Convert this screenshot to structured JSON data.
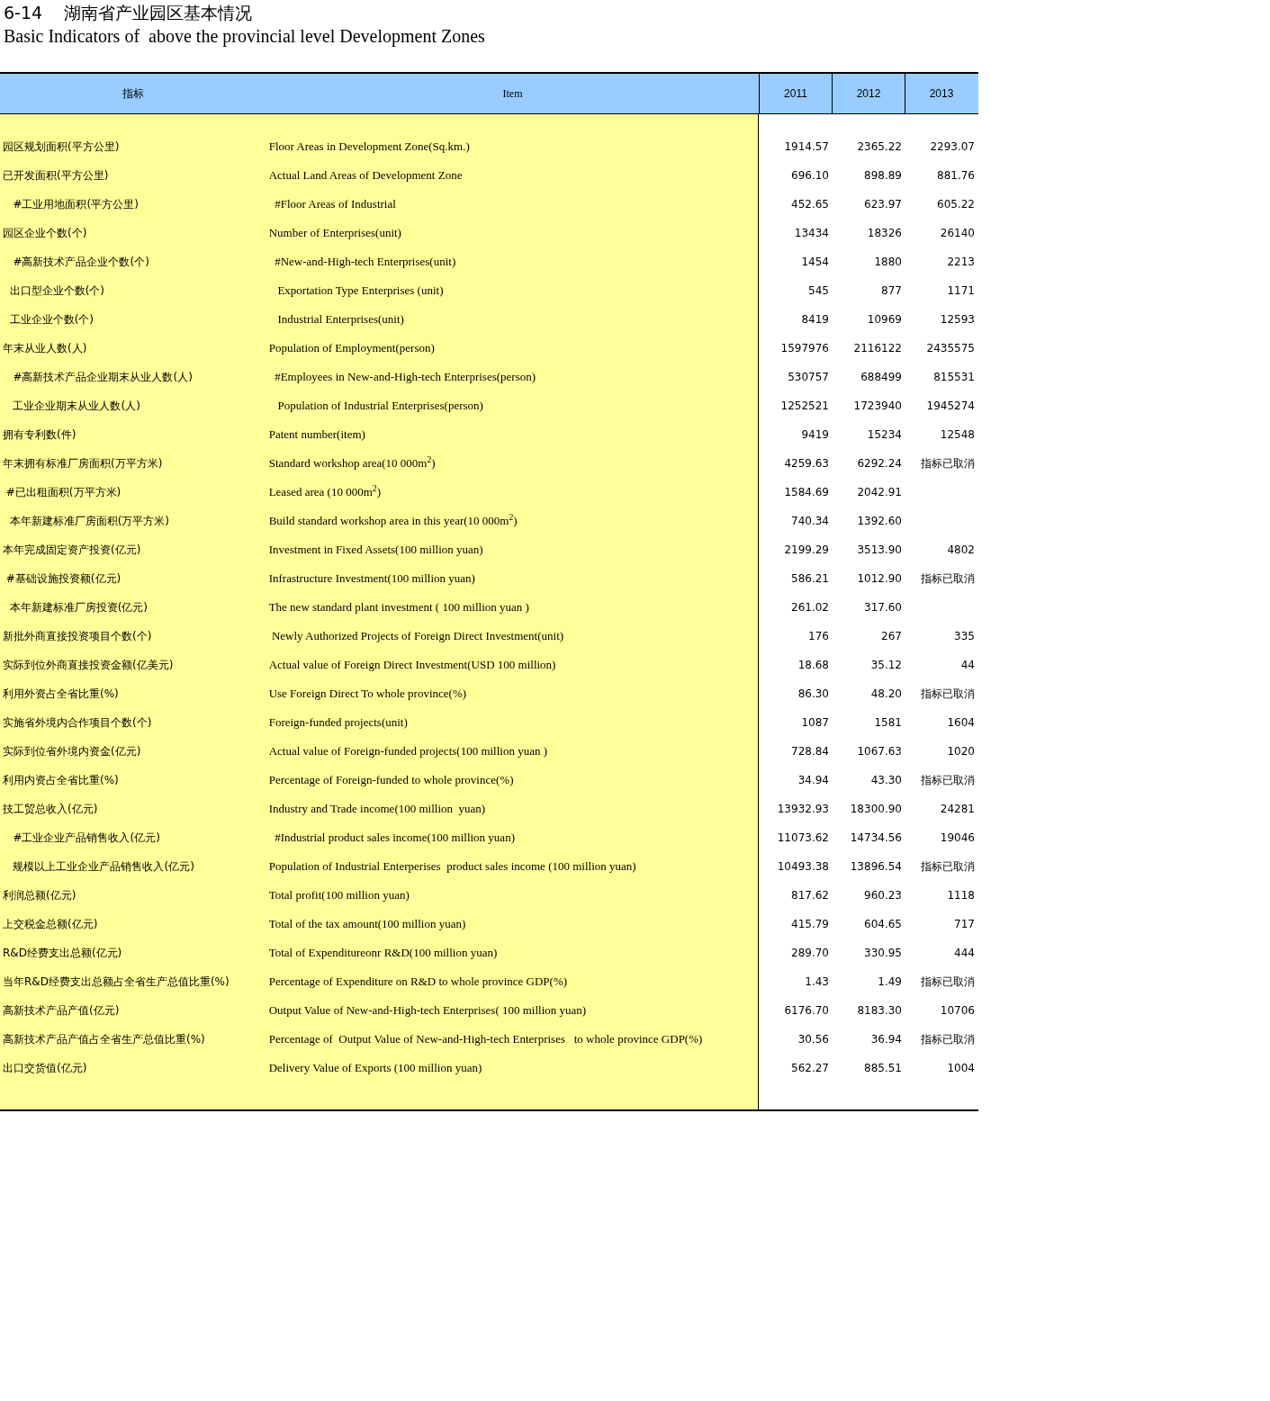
{
  "title": "6-14    湖南省产业园区基本情况",
  "subtitle": "Basic Indicators of  above the provincial level Development Zones",
  "columns": [
    "指标",
    "Item",
    "2011",
    "2012",
    "2013"
  ],
  "rows": [
    {
      "zh": "园区规划面积(平方公里)",
      "en": "Floor Areas in Development Zone(Sq.km.)",
      "value_2011": "1914.57",
      "value_2012": "2365.22",
      "value_2013": "2293.07"
    },
    {
      "zh": "已开发面积(平方公里)",
      "en": "Actual Land Areas of Development Zone",
      "value_2011": "696.10",
      "value_2012": "898.89",
      "value_2013": "881.76"
    },
    {
      "zh": "   #工业用地面积(平方公里)",
      "en": "  #Floor Areas of Industrial",
      "value_2011": "452.65",
      "value_2012": "623.97",
      "value_2013": "605.22"
    },
    {
      "zh": "园区企业个数(个)",
      "en": "Number of Enterprises(unit)",
      "value_2011": "13434",
      "value_2012": "18326",
      "value_2013": "26140"
    },
    {
      "zh": "   #高新技术产品企业个数(个)",
      "en": "  #New-and-High-tech Enterprises(unit)",
      "value_2011": "1454",
      "value_2012": "1880",
      "value_2013": "2213"
    },
    {
      "zh": "  出口型企业个数(个)",
      "en": "   Exportation Type Enterprises (unit)",
      "value_2011": "545",
      "value_2012": "877",
      "value_2013": "1171"
    },
    {
      "zh": "  工业企业个数(个)",
      "en": "   Industrial Enterprises(unit)",
      "value_2011": "8419",
      "value_2012": "10969",
      "value_2013": "12593"
    },
    {
      "zh": "年末从业人数(人)",
      "en": "Population of Employment(person)",
      "value_2011": "1597976",
      "value_2012": "2116122",
      "value_2013": "2435575"
    },
    {
      "zh": "   #高新技术产品企业期末从业人数(人)",
      "en": "  #Employees in New-and-High-tech Enterprises(person)",
      "value_2011": "530757",
      "value_2012": "688499",
      "value_2013": "815531"
    },
    {
      "zh": "   工业企业期末从业人数(人)",
      "en": "   Population of Industrial Enterprises(person)",
      "value_2011": "1252521",
      "value_2012": "1723940",
      "value_2013": "1945274"
    },
    {
      "zh": "拥有专利数(件)",
      "en": "Patent number(item)",
      "value_2011": "9419",
      "value_2012": "15234",
      "value_2013": "12548"
    },
    {
      "zh": "年末拥有标准厂房面积(万平方米)",
      "en": "Standard workshop area(10 000m$^{2}$)",
      "value_2011": "4259.63",
      "value_2012": "6292.24",
      "value_2013": "指标已取消"
    },
    {
      "zh": " #已出租面积(万平方米)",
      "en": "Leased area (10 000m$^{2}$)",
      "value_2011": "1584.69",
      "value_2012": "2042.91"
    },
    {
      "zh": "  本年新建标准厂房面积(万平方米)",
      "en": "Build standard workshop area in this year(10 000m$^{2}$)",
      "value_2011": "740.34",
      "value_2012": "1392.60"
    },
    {
      "zh": "本年完成固定资产投资(亿元)",
      "en": "Investment in Fixed Assets(100 million yuan)",
      "value_2011": "2199.29",
      "value_2012": "3513.90",
      "value_2013": "4802"
    },
    {
      "zh": " #基础设施投资额(亿元)",
      "en": "Infrastructure Investment(100 million yuan)",
      "value_2011": "586.21",
      "value_2012": "1012.90",
      "value_2013": "指标已取消"
    },
    {
      "zh": "  本年新建标准厂房投资(亿元)",
      "en": "The new standard plant investment ( 100 million yuan )",
      "value_2011": "261.02",
      "value_2012": "317.60"
    },
    {
      "zh": "新批外商直接投资项目个数(个)",
      "en": " Newly Authorized Projects of Foreign Direct Investment(unit)",
      "value_2011": "176",
      "value_2012": "267",
      "value_2013": "335"
    },
    {
      "zh": "实际到位外商直接投资金额(亿美元)",
      "en": "Actual value of Foreign Direct Investment(USD 100 million)",
      "value_2011": "18.68",
      "value_2012": "35.12",
      "value_2013": "44"
    },
    {
      "zh": "利用外资占全省比重(%)",
      "en": "Use Foreign Direct To whole province(%)",
      "value_2011": "86.30",
      "value_2012": "48.20",
      "value_2013": "指标已取消"
    },
    {
      "zh": "实施省外境内合作项目个数(个)",
      "en": "Foreign-funded projects(unit)",
      "value_2011": "1087",
      "value_2012": "1581",
      "value_2013": "1604"
    },
    {
      "zh": "实际到位省外境内资金(亿元)",
      "en": "Actual value of Foreign-funded projects(100 million yuan )",
      "value_2011": "728.84",
      "value_2012": "1067.63",
      "value_2013": "1020"
    },
    {
      "zh": "利用内资占全省比重(%)",
      "en": "Percentage of Foreign-funded to whole province(%)",
      "value_2011": "34.94",
      "value_2012": "43.30",
      "value_2013": "指标已取消"
    },
    {
      "zh": "技工贸总收入(亿元)",
      "en": "Industry and Trade income(100 million  yuan)",
      "value_2011": "13932.93",
      "value_2012": "18300.90",
      "value_2013": "24281"
    },
    {
      "zh": "   #工业企业产品销售收入(亿元)",
      "en": "  #Industrial product sales income(100 million yuan)",
      "value_2011": "11073.62",
      "value_2012": "14734.56",
      "value_2013": "19046"
    },
    {
      "zh": "   规模以上工业企业产品销售收入(亿元)",
      "en": "Population of Industrial Enterperises  product sales income (100 million yuan)",
      "value_2011": "10493.38",
      "value_2012": "13896.54",
      "value_2013": "指标已取消"
    },
    {
      "zh": "利润总额(亿元)",
      "en": "Total profit(100 million yuan)",
      "value_2011": "817.62",
      "value_2012": "960.23",
      "value_2013": "1118"
    },
    {
      "zh": "上交税金总额(亿元)",
      "en": "Total of the tax amount(100 million yuan)",
      "value_2011": "415.79",
      "value_2012": "604.65",
      "value_2013": "717"
    },
    {
      "zh": "R&D经费支出总额(亿元)",
      "en": "Total of Expenditureonr R&D(100 million yuan)",
      "value_2011": "289.70",
      "value_2012": "330.95",
      "value_2013": "444"
    },
    {
      "zh": "当年R&D经费支出总额占全省生产总值比重(%)",
      "en": "Percentage of Expenditure on R&D to whole province GDP(%)",
      "value_2011": "1.43",
      "value_2012": "1.49",
      "value_2013": "指标已取消"
    },
    {
      "zh": "高新技术产品产值(亿元)",
      "en": "Output Value of New-and-High-tech Enterprises( 100 million yuan)",
      "value_2011": "6176.70",
      "value_2012": "8183.30",
      "value_2013": "10706"
    },
    {
      "zh": "高新技术产品产值占全省生产总值比重(%)",
      "en": "Percentage of  Output Value of New-and-High-tech Enterprises   to whole province GDP(%)",
      "value_2011": "30.56",
      "value_2012": "36.94",
      "value_2013": "指标已取消"
    },
    {
      "zh": "出口交货值(亿元)",
      "en": "Delivery Value of Exports (100 million yuan)",
      "value_2011": "562.27",
      "value_2012": "885.51",
      "value_2013": "1004"
    }
  ]
}
